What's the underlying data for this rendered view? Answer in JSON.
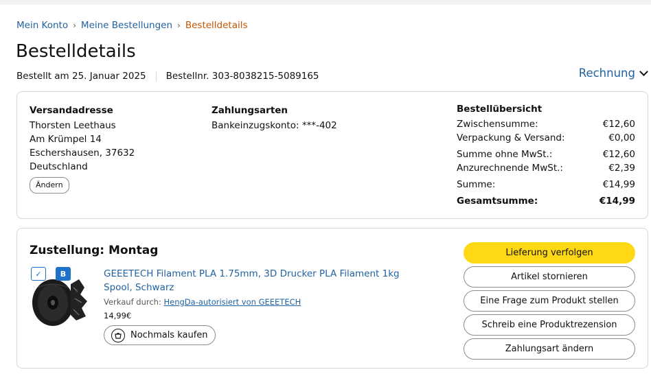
{
  "breadcrumb": {
    "items": [
      "Mein Konto",
      "Meine Bestellungen"
    ],
    "current": "Bestelldetails",
    "separator": "›"
  },
  "page_title": "Bestelldetails",
  "order_meta": {
    "ordered_on": "Bestellt am 25. Januar 2025",
    "order_number": "Bestellnr. 303-8038215-5089165"
  },
  "invoice_label": "Rechnung",
  "shipping": {
    "heading": "Versandadresse",
    "lines": [
      "Thorsten Leethaus",
      "Am Krümpel 14",
      "Eschershausen, 37632",
      "Deutschland"
    ],
    "edit_label": "Ändern"
  },
  "payment": {
    "heading": "Zahlungsarten",
    "method": "Bankeinzugskonto: ***-402"
  },
  "summary": {
    "heading": "Bestellübersicht",
    "rows": [
      {
        "label": "Zwischensumme:",
        "value": "€12,60"
      },
      {
        "label": "Verpackung & Versand:",
        "value": "€0,00"
      },
      {
        "label": "Summe ohne MwSt.:",
        "value": "€12,60"
      },
      {
        "label": "Anzurechnende MwSt.:",
        "value": "€2,39"
      },
      {
        "label": "Summe:",
        "value": "€14,99"
      },
      {
        "label": "Gesamtsumme:",
        "value": "€14,99"
      }
    ]
  },
  "delivery": {
    "heading": "Zustellung: Montag",
    "product": {
      "title": "GEEETECH Filament PLA 1.75mm, 3D Drucker PLA Filament 1kg Spool, Schwarz",
      "seller_prefix": "Verkauf durch:",
      "seller_name": "HengDa-autorisiert von GEEETECH",
      "price": "14,99€",
      "badge_b": "B",
      "badge_check": "✓",
      "rebuy_label": "Nochmals kaufen"
    },
    "actions": [
      "Lieferung verfolgen",
      "Artikel stornieren",
      "Eine Frage zum Produkt stellen",
      "Schreib eine Produktrezension",
      "Zahlungsart ändern"
    ]
  },
  "colors": {
    "link": "#2162a1",
    "breadcrumb_current": "#c45500",
    "primary_button": "#ffd814",
    "badge_blue": "#1e73c9"
  },
  "icons": [
    "chevron-down-icon",
    "check-icon",
    "rebuy-icon"
  ]
}
